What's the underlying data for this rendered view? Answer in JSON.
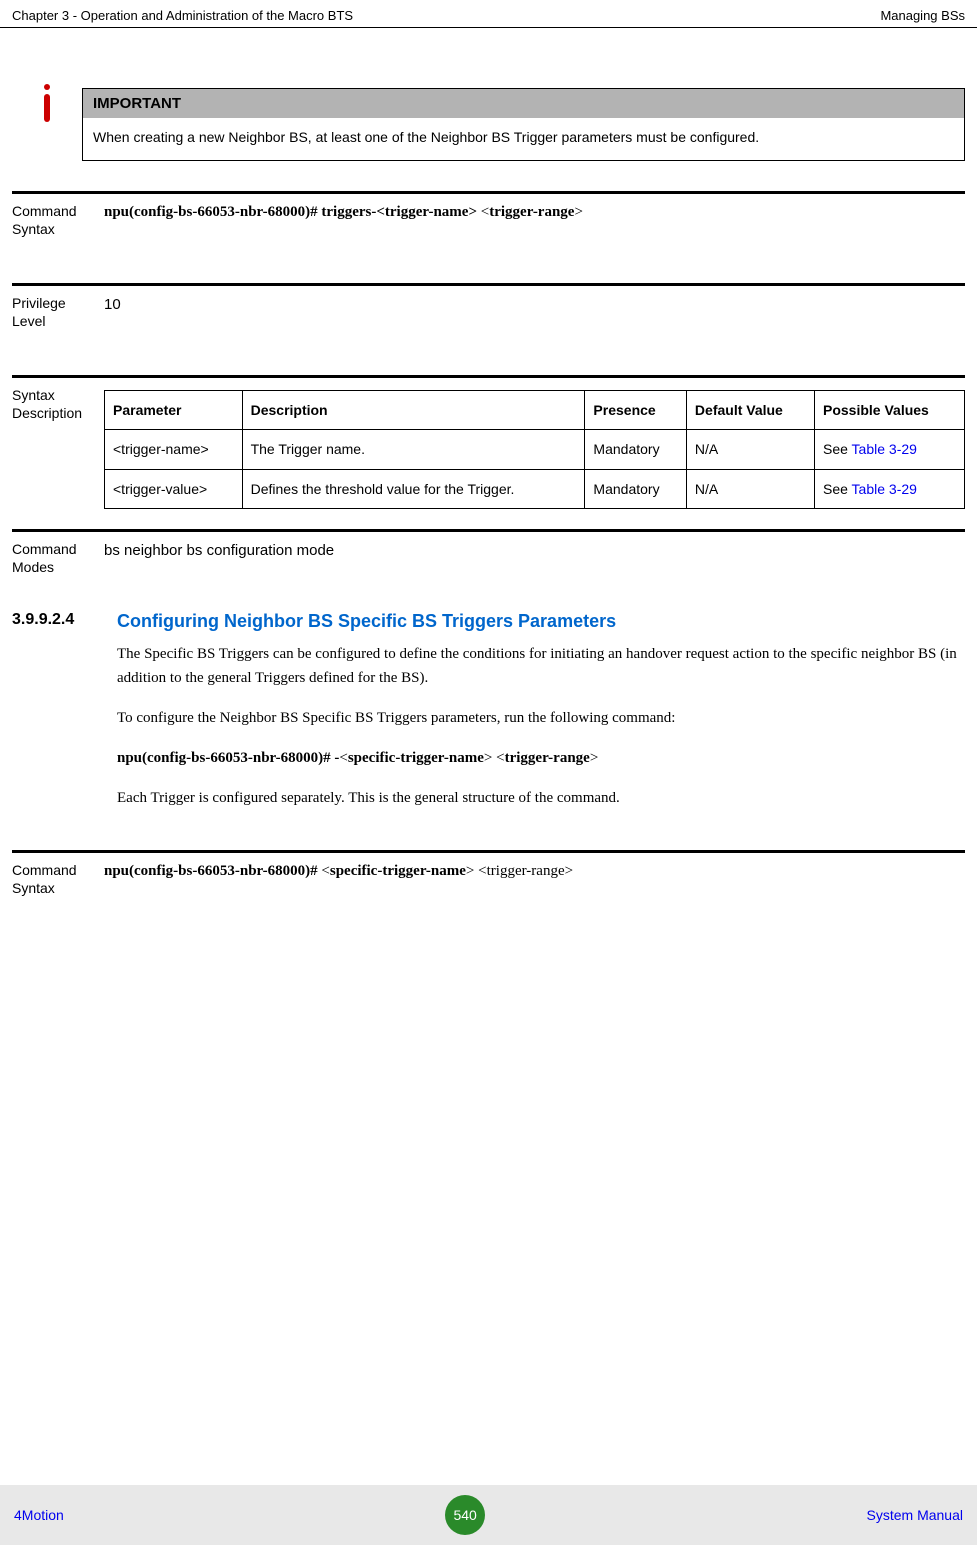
{
  "header": {
    "left": "Chapter 3 - Operation and Administration of the Macro BTS",
    "right": "Managing BSs"
  },
  "important": {
    "title": "IMPORTANT",
    "text": "When creating a new Neighbor BS, at least one of the Neighbor BS Trigger parameters must be configured."
  },
  "blocks": {
    "cmd_syntax1": {
      "label": "Command Syntax",
      "prefix": "npu(config-bs-66053-nbr-68000)# triggers-",
      "p1": "<trigger-name>",
      "sep": "  ",
      "p2": "<trigger-range>"
    },
    "priv": {
      "label": "Privilege Level",
      "value": "10"
    },
    "syntax_desc": {
      "label": "Syntax Description"
    },
    "cmd_modes": {
      "label": "Command Modes",
      "value": "bs neighbor bs configuration mode"
    },
    "cmd_syntax2": {
      "label": "Command Syntax",
      "prefix": "npu(config-bs-66053-nbr-68000)# ",
      "p1": "<specific-trigger-name>",
      "sep": "  ",
      "p2": "<trigger-range>"
    }
  },
  "table": {
    "headers": [
      "Parameter",
      "Description",
      "Presence",
      "Default Value",
      "Possible Values"
    ],
    "rows": [
      {
        "param": "<trigger-name>",
        "desc": "The Trigger name.",
        "presence": "Mandatory",
        "default": "N/A",
        "possible_pre": "See ",
        "possible_link": "Table 3-29"
      },
      {
        "param": "<trigger-value>",
        "desc": "Defines the threshold value for the Trigger.",
        "presence": "Mandatory",
        "default": "N/A",
        "possible_pre": "See ",
        "possible_link": "Table 3-29"
      }
    ]
  },
  "section": {
    "num": "3.9.9.2.4",
    "title": "Configuring Neighbor BS Specific BS Triggers Parameters",
    "p1": "The Specific BS Triggers can be configured to define the conditions for initiating an handover request action to the specific neighbor BS (in addition to the general Triggers defined for the BS).",
    "p2": "To configure the Neighbor BS Specific BS Triggers parameters, run the following command:",
    "cmd_prefix": "npu(config-bs-66053-nbr-68000)# -",
    "cmd_p1": "<specific-trigger-name>",
    "cmd_sep": " ",
    "cmd_p2": "<trigger-range>",
    "p3": "Each Trigger is configured separately. This is the general structure of the command."
  },
  "footer": {
    "left": "4Motion",
    "page": "540",
    "right": "System Manual"
  }
}
